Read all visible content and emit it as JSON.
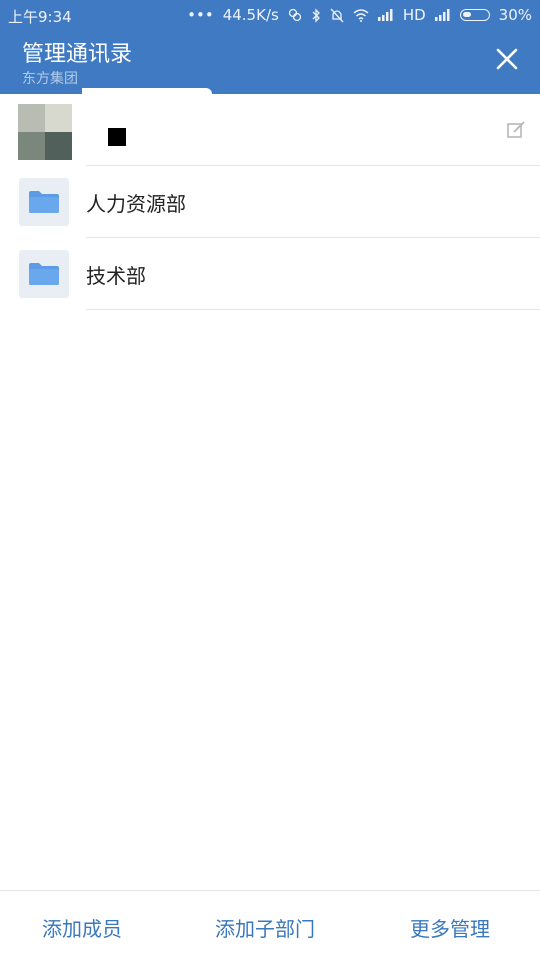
{
  "status_bar": {
    "time": "上午9:34",
    "speed": "44.5K/s",
    "network": "HD",
    "battery": "30%",
    "icons": [
      "dots-icon",
      "clover-icon",
      "bluetooth-icon",
      "bell-muted-icon",
      "wifi-icon",
      "signal-icon",
      "signal-icon",
      "battery-icon"
    ]
  },
  "header": {
    "title": "管理通讯录",
    "subtitle": "东方集团",
    "close_icon": "close-icon"
  },
  "org": {
    "name": "■",
    "edit_icon": "edit-icon"
  },
  "departments": [
    {
      "label": "人力资源部",
      "icon": "folder-icon"
    },
    {
      "label": "技术部",
      "icon": "folder-icon"
    }
  ],
  "bottom_bar": {
    "add_member": "添加成员",
    "add_sub_department": "添加子部门",
    "more_management": "更多管理"
  },
  "colors": {
    "header": "#3f7ac3",
    "accent": "#3a78bd",
    "folder": "#5d9ce5"
  }
}
